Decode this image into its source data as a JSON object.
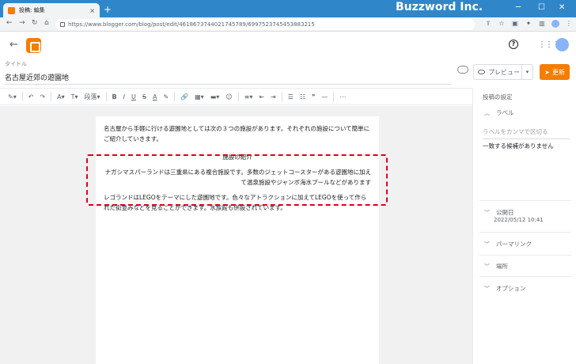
{
  "browser": {
    "tab_title": "投稿: 編集",
    "tab_close": "×",
    "new_tab": "+",
    "brand": "Buzzword Inc.",
    "url": "https://www.blogger.com/blog/post/edit/4618673744021745789/6997523745453883215",
    "win_min": "─",
    "win_max": "☐",
    "win_close": "✕"
  },
  "colors": {
    "accent": "#f57d00",
    "chrome": "#2f87c9",
    "highlight": "#e0001a"
  },
  "appbar": {
    "back": "←",
    "help": "?",
    "apps": "⋮⋮⋮"
  },
  "title_area": {
    "label": "タイトル",
    "value": "名古屋近郊の遊園地",
    "preview": "プレビュー",
    "update": "更新"
  },
  "toolbar": {
    "paragraph": "段落",
    "items": [
      "✎▾",
      "↶",
      "↷",
      "A▾",
      "T▾",
      "段落▾",
      "B",
      "I",
      "U",
      "S",
      "A",
      "✎",
      "🔗",
      "▦▾",
      "▬▾",
      "☺",
      "≡▾",
      "⇤",
      "⇥",
      "☰",
      "☷",
      "❞",
      "—",
      "⋯"
    ]
  },
  "content": {
    "p1": "名古屋から手軽に行ける遊園地としては次の３つの施設があります。それぞれの施設について簡単にご紹介していきます。",
    "caption": "施設の紹介",
    "p2": "ナガシマスパーランドは三重県にある複合施設です。多数のジェットコースターがある遊園地に加えて温泉施設やジャンボ海水プールなどがあります",
    "p3": "レゴランドはLEGOをテーマにした遊園地です。色々なアトラクションに加えてLEGOを使って作られた街並みなどを見ることができます。水族館も併設されています。"
  },
  "sidebar": {
    "title": "投稿の設定",
    "label_heading": "ラベル",
    "label_placeholder": "ラベルをカンマで区切る",
    "no_match": "一致する候補がありません",
    "publish_heading": "公開日",
    "publish_date": "2022/05/12 10:41",
    "permalink": "パーマリンク",
    "location": "場所",
    "options": "オプション"
  }
}
